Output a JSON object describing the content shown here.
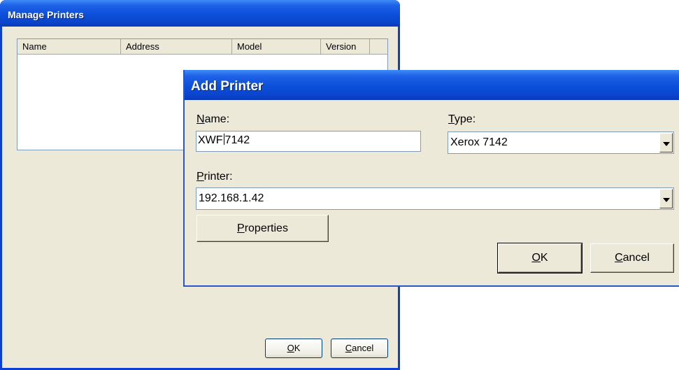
{
  "manage_printers": {
    "title": "Manage Printers",
    "columns": [
      "Name",
      "Address",
      "Model",
      "Version"
    ],
    "rows": [],
    "ok_button": {
      "underline": "O",
      "rest": "K"
    },
    "cancel_button": {
      "underline": "C",
      "rest": "ancel"
    }
  },
  "add_printer": {
    "title": "Add Printer",
    "name_label": {
      "underline": "N",
      "rest": "ame:"
    },
    "name_value": {
      "before_caret": "XWF",
      "after_caret": "7142"
    },
    "type_label": {
      "underline": "T",
      "rest": "ype:"
    },
    "type_value": "Xerox 7142",
    "printer_label": {
      "underline": "P",
      "rest": "rinter:"
    },
    "printer_value": "192.168.1.42",
    "properties_button": {
      "underline": "P",
      "rest": "roperties"
    },
    "ok_button": {
      "underline": "O",
      "rest": "K"
    },
    "cancel_button": {
      "underline": "C",
      "rest": "ancel"
    }
  },
  "theme": {
    "titlebar_blue": "#0a44cc",
    "dialog_face": "#ece9d8",
    "field_border": "#7f9db9"
  }
}
